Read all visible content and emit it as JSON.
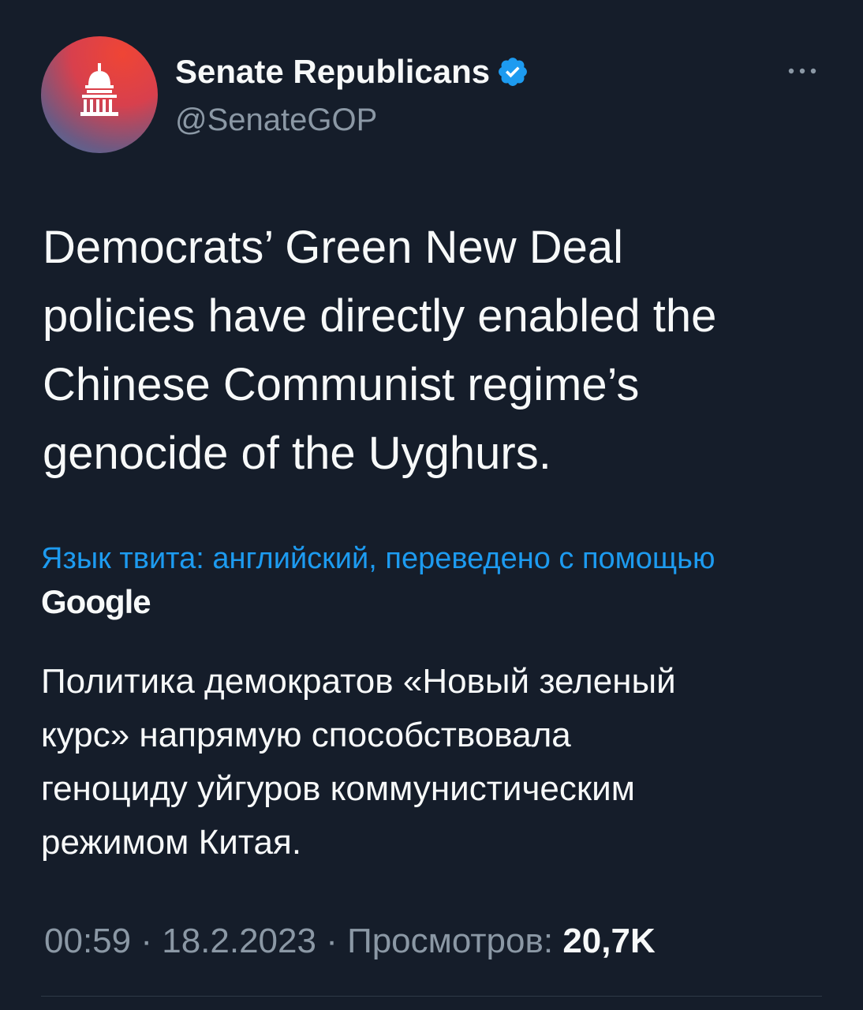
{
  "author": {
    "display_name": "Senate Republicans",
    "handle": "@SenateGOP",
    "verified": true
  },
  "tweet": {
    "text_lines": [
      "Democrats’ Green New Deal",
      "policies have directly enabled the",
      "Chinese Communist regime’s",
      "genocide of the Uyghurs."
    ]
  },
  "translation": {
    "note": "Язык твита: английский, переведено с помощью",
    "provider": "Google",
    "text_lines": [
      "Политика демократов «Новый зеленый",
      "курс» напрямую способствовала",
      "геноциду уйгуров коммунистическим",
      "режимом Китая."
    ]
  },
  "meta": {
    "time": "00:59",
    "separator": " · ",
    "date": "18.2.2023",
    "views_label": "Просмотров: ",
    "views_count": "20,7K"
  },
  "icons": {
    "avatar": "capitol-dome-icon",
    "verified": "verified-badge-icon",
    "more": "more-options-icon"
  },
  "colors": {
    "background": "#151d2a",
    "accent": "#1d9bf0",
    "secondary_text": "#8b98a5",
    "avatar_red": "#ef4535",
    "avatar_blue": "#3c74a6"
  }
}
